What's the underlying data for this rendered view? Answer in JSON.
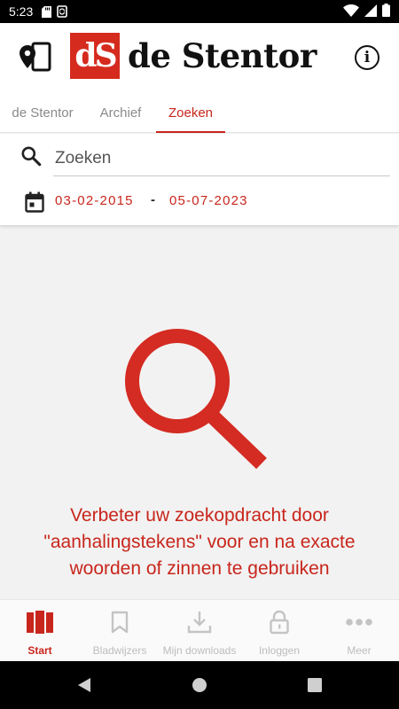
{
  "status_bar": {
    "time": "5:23"
  },
  "header": {
    "logo_mark": "dS",
    "logo_text": "de Stentor",
    "info_label": "i"
  },
  "tabs": [
    {
      "label": "de Stentor",
      "active": false
    },
    {
      "label": "Archief",
      "active": false
    },
    {
      "label": "Zoeken",
      "active": true
    }
  ],
  "search": {
    "placeholder": "Zoeken",
    "value": "",
    "date_from": "03-02-2015",
    "date_separator": "-",
    "date_to": "05-07-2023"
  },
  "empty_state": {
    "message": "Verbeter uw zoekopdracht door \"aanhalingstekens\" voor en na exacte woorden of zinnen te gebruiken"
  },
  "bottom_nav": [
    {
      "label": "Start",
      "icon": "newspaper-icon",
      "active": true
    },
    {
      "label": "Bladwijzers",
      "icon": "bookmark-icon",
      "active": false
    },
    {
      "label": "Mijn downloads",
      "icon": "download-icon",
      "active": false
    },
    {
      "label": "Inloggen",
      "icon": "lock-icon",
      "active": false
    },
    {
      "label": "Meer",
      "icon": "more-icon",
      "active": false
    }
  ],
  "colors": {
    "accent": "#c8261c",
    "logo_red": "#d52b1e",
    "inactive": "#bdbdbd"
  }
}
